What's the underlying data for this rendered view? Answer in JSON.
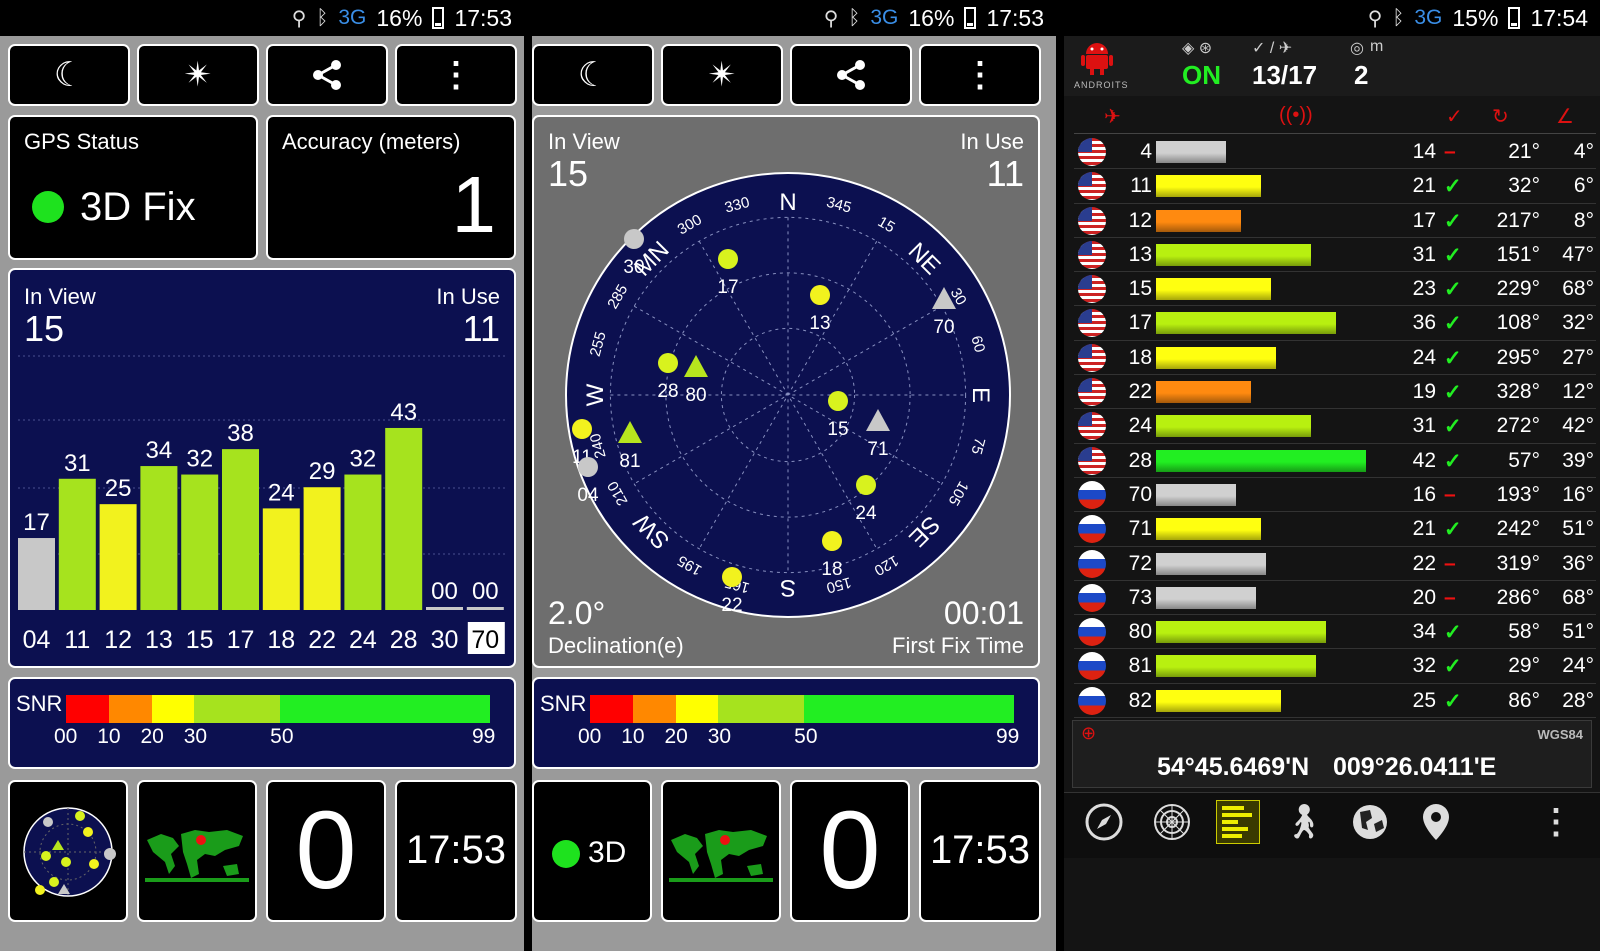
{
  "status_bars": [
    {
      "network": "3G",
      "battery": "16%",
      "time": "17:53"
    },
    {
      "network": "3G",
      "battery": "16%",
      "time": "17:53"
    },
    {
      "network": "3G",
      "battery": "15%",
      "time": "17:54"
    }
  ],
  "toolbar": {
    "night_icon": "☾",
    "sky_icon": "✴",
    "share_icon": "share-icon",
    "menu_icon": "⋮"
  },
  "gps_status": {
    "title": "GPS Status",
    "value": "3D Fix",
    "dot_color": "#1ee21e"
  },
  "accuracy": {
    "title": "Accuracy (meters)",
    "value": "1"
  },
  "signal_panel": {
    "in_view_label": "In View",
    "in_view": "15",
    "in_use_label": "In Use",
    "in_use": "11",
    "bars": [
      {
        "prn": "04",
        "snr": 17,
        "label": "17",
        "color": "#c8c8c8"
      },
      {
        "prn": "11",
        "snr": 31,
        "label": "31",
        "color": "#a6e31e"
      },
      {
        "prn": "12",
        "snr": 25,
        "label": "25",
        "color": "#f2f21e"
      },
      {
        "prn": "13",
        "snr": 34,
        "label": "34",
        "color": "#a6e31e"
      },
      {
        "prn": "15",
        "snr": 32,
        "label": "32",
        "color": "#a6e31e"
      },
      {
        "prn": "17",
        "snr": 38,
        "label": "38",
        "color": "#a6e31e"
      },
      {
        "prn": "18",
        "snr": 24,
        "label": "24",
        "color": "#f2f21e"
      },
      {
        "prn": "22",
        "snr": 29,
        "label": "29",
        "color": "#f2f21e"
      },
      {
        "prn": "24",
        "snr": 32,
        "label": "32",
        "color": "#a6e31e"
      },
      {
        "prn": "28",
        "snr": 43,
        "label": "43",
        "color": "#a6e31e"
      },
      {
        "prn": "30",
        "snr": 0,
        "label": "00",
        "color": "#c8c8c8"
      },
      {
        "prn": "70",
        "snr": 0,
        "label": "00",
        "color": "#c8c8c8"
      }
    ]
  },
  "snr_legend": {
    "label": "SNR",
    "ticks": [
      "00",
      "10",
      "20",
      "30",
      "50",
      "99"
    ],
    "colors": [
      "#ff0000",
      "#ff8800",
      "#ffff00",
      "#a6e31e",
      "#22ee22"
    ]
  },
  "sky": {
    "in_view_label": "In View",
    "in_view": "15",
    "in_use_label": "In Use",
    "in_use": "11",
    "declination": "2.0°",
    "declination_label": "Declination(e)",
    "first_fix": "00:01",
    "first_fix_label": "First Fix Time",
    "compass": [
      "SE",
      "S",
      "SW",
      "W",
      "MN",
      "N",
      "NE",
      "E"
    ],
    "degrees": [
      "105",
      "120",
      "150",
      "165",
      "195",
      "210",
      "240",
      "255",
      "285",
      "300",
      "330",
      "345",
      "15",
      "30",
      "60",
      "75"
    ],
    "satellites": [
      {
        "prn": "30",
        "shape": "dot",
        "color": "#c8c8c8"
      },
      {
        "prn": "17",
        "shape": "dot",
        "color": "#d8f21e"
      },
      {
        "prn": "13",
        "shape": "dot",
        "color": "#f2f21e"
      },
      {
        "prn": "70",
        "shape": "tri",
        "color": "#c8c8c8"
      },
      {
        "prn": "28",
        "shape": "dot",
        "color": "#d8f21e"
      },
      {
        "prn": "80",
        "shape": "tri",
        "color": "#b7e51e"
      },
      {
        "prn": "15",
        "shape": "dot",
        "color": "#d8f21e"
      },
      {
        "prn": "71",
        "shape": "tri",
        "color": "#c8c8c8"
      },
      {
        "prn": "11",
        "shape": "dot",
        "color": "#f2f21e"
      },
      {
        "prn": "81",
        "shape": "tri",
        "color": "#b7e51e"
      },
      {
        "prn": "04",
        "shape": "dot",
        "color": "#c8c8c8"
      },
      {
        "prn": "24",
        "shape": "dot",
        "color": "#d8f21e"
      },
      {
        "prn": "18",
        "shape": "dot",
        "color": "#f2f21e"
      },
      {
        "prn": "22",
        "shape": "dot",
        "color": "#f2f21e"
      }
    ]
  },
  "bottom_tiles": {
    "count": "0",
    "time": "17:53",
    "fix": "3D"
  },
  "androits": {
    "logo": "ANDROITS",
    "status_value": "ON",
    "sats_value": "13/17",
    "m_label": "m",
    "m_value": "2",
    "rows": [
      {
        "flag": "us",
        "prn": "4",
        "snr": "14",
        "used": false,
        "azimuth": "21°",
        "elevation": "4°",
        "color": "#d0d0d0",
        "level": 14
      },
      {
        "flag": "us",
        "prn": "11",
        "snr": "21",
        "used": true,
        "azimuth": "32°",
        "elevation": "6°",
        "color": "#ffff10",
        "level": 21
      },
      {
        "flag": "us",
        "prn": "12",
        "snr": "17",
        "used": true,
        "azimuth": "217°",
        "elevation": "8°",
        "color": "#ff8a10",
        "level": 17
      },
      {
        "flag": "us",
        "prn": "13",
        "snr": "31",
        "used": true,
        "azimuth": "151°",
        "elevation": "47°",
        "color": "#b8f010",
        "level": 31
      },
      {
        "flag": "us",
        "prn": "15",
        "snr": "23",
        "used": true,
        "azimuth": "229°",
        "elevation": "68°",
        "color": "#ffff10",
        "level": 23
      },
      {
        "flag": "us",
        "prn": "17",
        "snr": "36",
        "used": true,
        "azimuth": "108°",
        "elevation": "32°",
        "color": "#b8f010",
        "level": 36
      },
      {
        "flag": "us",
        "prn": "18",
        "snr": "24",
        "used": true,
        "azimuth": "295°",
        "elevation": "27°",
        "color": "#ffff10",
        "level": 24
      },
      {
        "flag": "us",
        "prn": "22",
        "snr": "19",
        "used": true,
        "azimuth": "328°",
        "elevation": "12°",
        "color": "#ff8a10",
        "level": 19
      },
      {
        "flag": "us",
        "prn": "24",
        "snr": "31",
        "used": true,
        "azimuth": "272°",
        "elevation": "42°",
        "color": "#b8f010",
        "level": 31
      },
      {
        "flag": "us",
        "prn": "28",
        "snr": "42",
        "used": true,
        "azimuth": "57°",
        "elevation": "39°",
        "color": "#22ee22",
        "level": 42
      },
      {
        "flag": "ru",
        "prn": "70",
        "snr": "16",
        "used": false,
        "azimuth": "193°",
        "elevation": "16°",
        "color": "#d0d0d0",
        "level": 16
      },
      {
        "flag": "ru",
        "prn": "71",
        "snr": "21",
        "used": true,
        "azimuth": "242°",
        "elevation": "51°",
        "color": "#ffff10",
        "level": 21
      },
      {
        "flag": "ru",
        "prn": "72",
        "snr": "22",
        "used": false,
        "azimuth": "319°",
        "elevation": "36°",
        "color": "#d0d0d0",
        "level": 22
      },
      {
        "flag": "ru",
        "prn": "73",
        "snr": "20",
        "used": false,
        "azimuth": "286°",
        "elevation": "68°",
        "color": "#d0d0d0",
        "level": 20
      },
      {
        "flag": "ru",
        "prn": "80",
        "snr": "34",
        "used": true,
        "azimuth": "58°",
        "elevation": "51°",
        "color": "#b8f010",
        "level": 34
      },
      {
        "flag": "ru",
        "prn": "81",
        "snr": "32",
        "used": true,
        "azimuth": "29°",
        "elevation": "24°",
        "color": "#b8f010",
        "level": 32
      },
      {
        "flag": "ru",
        "prn": "82",
        "snr": "25",
        "used": true,
        "azimuth": "86°",
        "elevation": "28°",
        "color": "#ffff10",
        "level": 25
      }
    ],
    "datum": "WGS84",
    "latitude": "54°45.6469'N",
    "longitude": "009°26.0411'E"
  }
}
